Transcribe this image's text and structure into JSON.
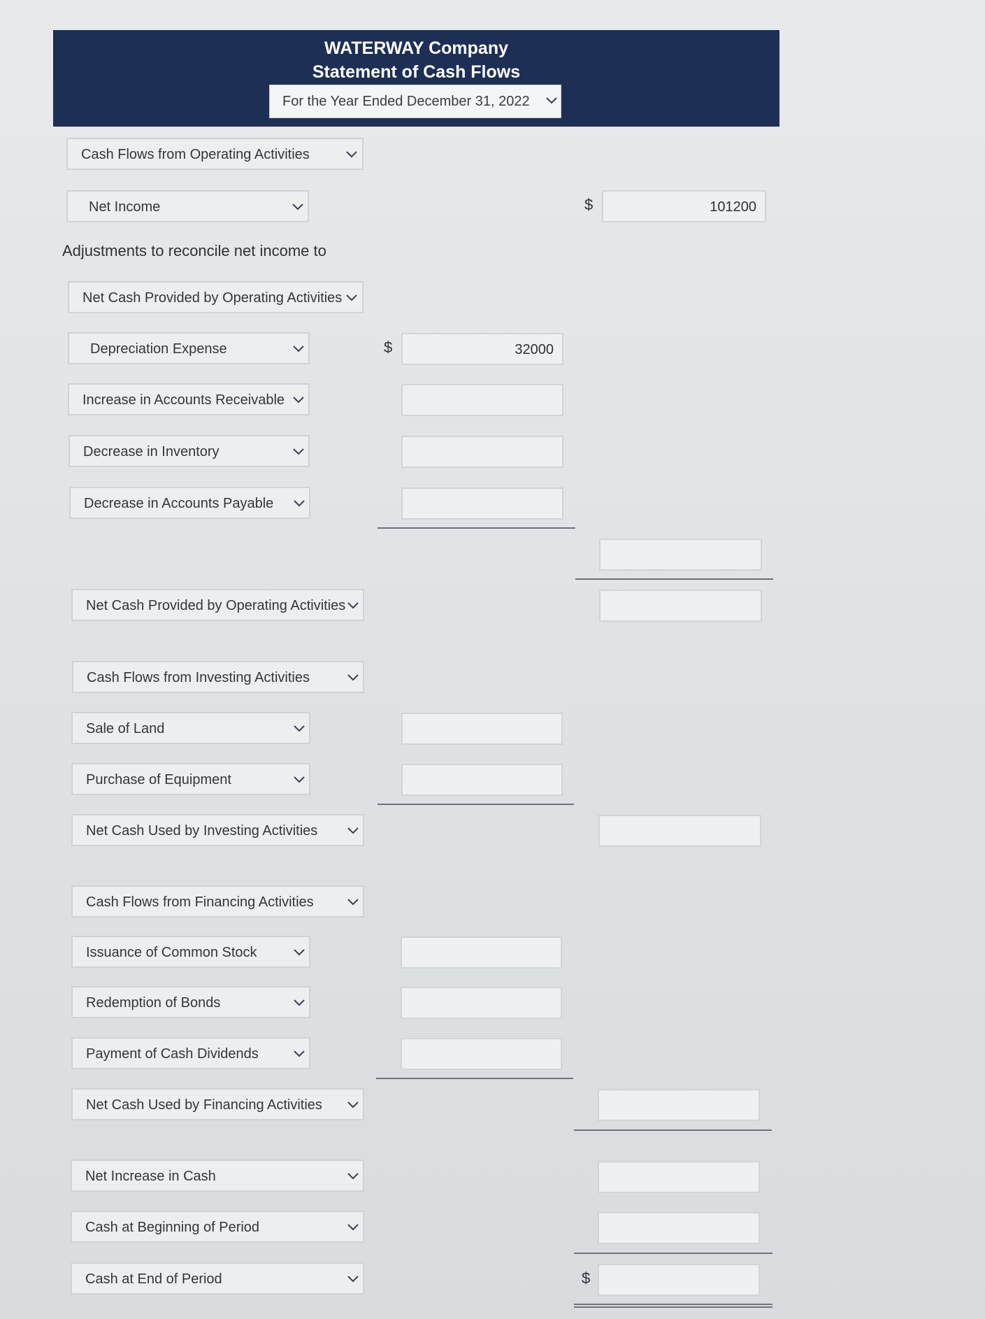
{
  "header": {
    "company": "WATERWAY Company",
    "statement": "Statement of Cash Flows",
    "period": "For the Year Ended December 31, 2022"
  },
  "labels": {
    "adjustments": "Adjustments to reconcile net income to",
    "currency": "$"
  },
  "rows": {
    "operating_heading": "Cash Flows from Operating Activities",
    "net_income": "Net Income",
    "net_income_value": "101200",
    "adjustments_heading": "Net Cash Provided by Operating Activities",
    "depreciation": "Depreciation Expense",
    "depreciation_value": "32000",
    "accounts_receivable": "Increase in Accounts Receivable",
    "inventory": "Decrease in Inventory",
    "accounts_payable": "Decrease in Accounts Payable",
    "net_operating": "Net Cash Provided by Operating Activities",
    "investing_heading": "Cash Flows from Investing Activities",
    "sale_land": "Sale of Land",
    "purchase_equipment": "Purchase of Equipment",
    "net_investing": "Net Cash Used by Investing Activities",
    "financing_heading": "Cash Flows from Financing Activities",
    "issuance_stock": "Issuance of Common Stock",
    "redemption_bonds": "Redemption of Bonds",
    "payment_dividends": "Payment of Cash Dividends",
    "net_financing": "Net Cash Used by Financing Activities",
    "net_increase": "Net Increase in Cash",
    "cash_beginning": "Cash at Beginning of Period",
    "cash_end": "Cash at End of Period"
  }
}
